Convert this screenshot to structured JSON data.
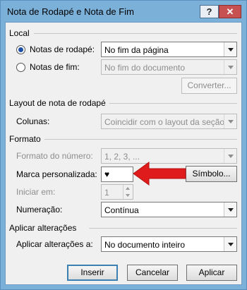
{
  "window": {
    "title": "Nota de Rodapé e Nota de Fim",
    "help_label": "?",
    "close_label": "✕"
  },
  "local": {
    "title": "Local",
    "footnotes_label": "Notas de rodapé:",
    "footnotes_value": "No fim da página",
    "endnotes_label": "Notas de fim:",
    "endnotes_value": "No fim do documento",
    "convert_label": "Converter..."
  },
  "layout": {
    "title": "Layout de nota de rodapé",
    "columns_label": "Colunas:",
    "columns_value": "Coincidir com o layout da seção"
  },
  "format": {
    "title": "Formato",
    "number_format_label": "Formato do número:",
    "number_format_value": "1, 2, 3, ...",
    "custom_mark_label": "Marca personalizada:",
    "custom_mark_value": "♥",
    "symbol_label": "Símbolo...",
    "start_at_label": "Iniciar em:",
    "start_at_value": "1",
    "numbering_label": "Numeração:",
    "numbering_value": "Contínua"
  },
  "apply": {
    "title": "Aplicar alterações",
    "apply_to_label": "Aplicar alterações a:",
    "apply_to_value": "No documento inteiro"
  },
  "buttons": {
    "insert": "Inserir",
    "cancel": "Cancelar",
    "apply": "Aplicar"
  },
  "colors": {
    "titlebar": "#7bb0d9",
    "close": "#c75050",
    "annotation_arrow": "#e01b1b",
    "radio_dot": "#1b4fa8"
  }
}
